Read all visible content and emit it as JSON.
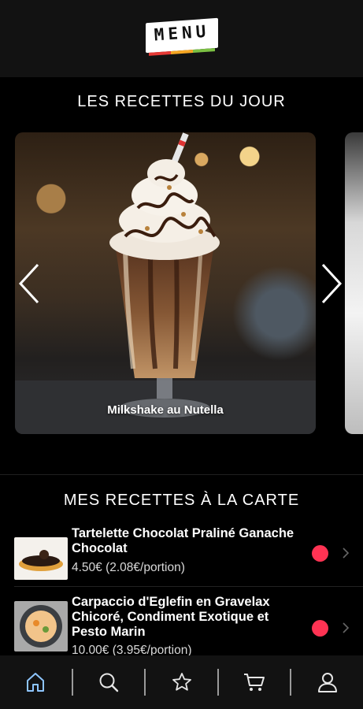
{
  "header": {
    "logo_text": "MENU",
    "stripe_colors": [
      "#e53935",
      "#f5a623",
      "#7bc043"
    ]
  },
  "daily": {
    "title": "LES RECETTES DU JOUR",
    "cards": [
      {
        "caption": "Milkshake au Nutella"
      }
    ]
  },
  "menu": {
    "title": "MES RECETTES À LA CARTE",
    "items": [
      {
        "title": "Tartelette Chocolat Praliné Ganache Chocolat",
        "price": "4.50€ (2.08€/portion)"
      },
      {
        "title": "Carpaccio d'Eglefin en Gravelax Chicoré, Condiment Exotique et Pesto Marin",
        "price": "10.00€ (3.95€/portion)"
      }
    ]
  },
  "tabbar": {
    "items": [
      "home-icon",
      "search-icon",
      "star-icon",
      "cart-icon",
      "user-icon"
    ]
  },
  "colors": {
    "accent_dot": "#ff3353",
    "header_bg": "#121212",
    "background": "#000000"
  }
}
